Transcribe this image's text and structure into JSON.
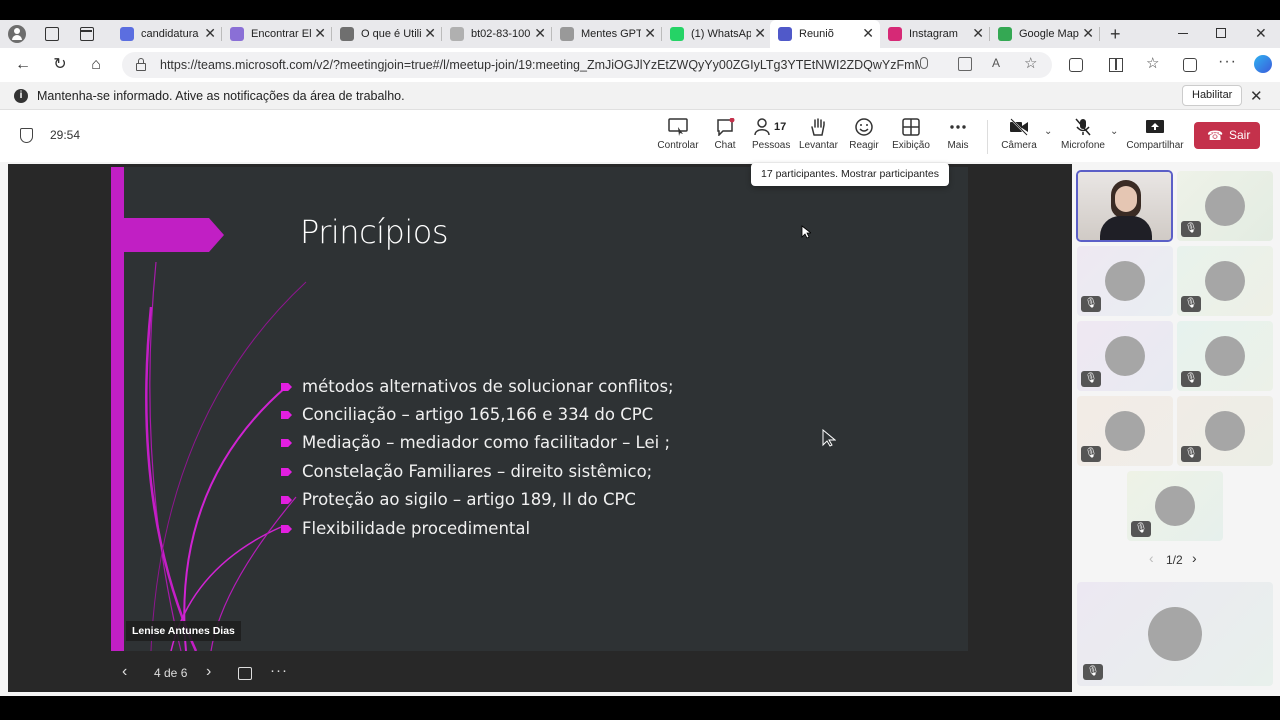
{
  "browser": {
    "tabs": [
      {
        "label": "candidatura",
        "color": "#5b6ee0"
      },
      {
        "label": "Encontrar Ele",
        "color": "#8a6fd6"
      },
      {
        "label": "O que é Utili",
        "color": "#6f6f6f"
      },
      {
        "label": "bt02-83-100",
        "color": "#b0b0b0"
      },
      {
        "label": "Mentes GPT-",
        "color": "#999999"
      },
      {
        "label": "(1) WhatsApp",
        "color": "#25d366"
      },
      {
        "label": "Reuniõ",
        "color": "#5059c9"
      },
      {
        "label": "Instagram",
        "color": "#d62976"
      },
      {
        "label": "Google Map",
        "color": "#34a853"
      }
    ],
    "url": "https://teams.microsoft.com/v2/?meetingjoin=true#/l/meetup-join/19:meeting_ZmJiOGJlYzEtZWQyYy00ZGIyLTg3YTEtNWI2ZDQwYzFmMWY5@..."
  },
  "infobar": {
    "message": "Mantenha-se informado. Ative as notificações da área de trabalho.",
    "button": "Habilitar"
  },
  "meeting": {
    "timer": "29:54",
    "people_count": "17",
    "controls": {
      "control": "Controlar",
      "chat": "Chat",
      "people": "Pessoas",
      "raise": "Levantar",
      "react": "Reagir",
      "view": "Exibição",
      "more": "Mais",
      "camera": "Câmera",
      "mic": "Microfone",
      "share": "Compartilhar",
      "leave": "Sair"
    },
    "tooltip": "17 participantes. Mostrar participantes",
    "presenter": "Lenise Antunes Dias",
    "slide_counter": "4 de 6",
    "participants_page": "1/2"
  },
  "slide": {
    "title": "Princípios",
    "bullets": [
      "métodos alternativos de solucionar conflitos;",
      "Conciliação – artigo 165,166 e 334  do CPC",
      "Mediação – mediador como facilitador – Lei  ;",
      "Constelação Familiares – direito sistêmico;",
      "Proteção ao sigilo – artigo 189, II do CPC",
      "Flexibilidade procedimental"
    ]
  },
  "colors": {
    "accent": "#c11fc4",
    "leave": "#c4314b",
    "teams": "#5b5fc7"
  }
}
